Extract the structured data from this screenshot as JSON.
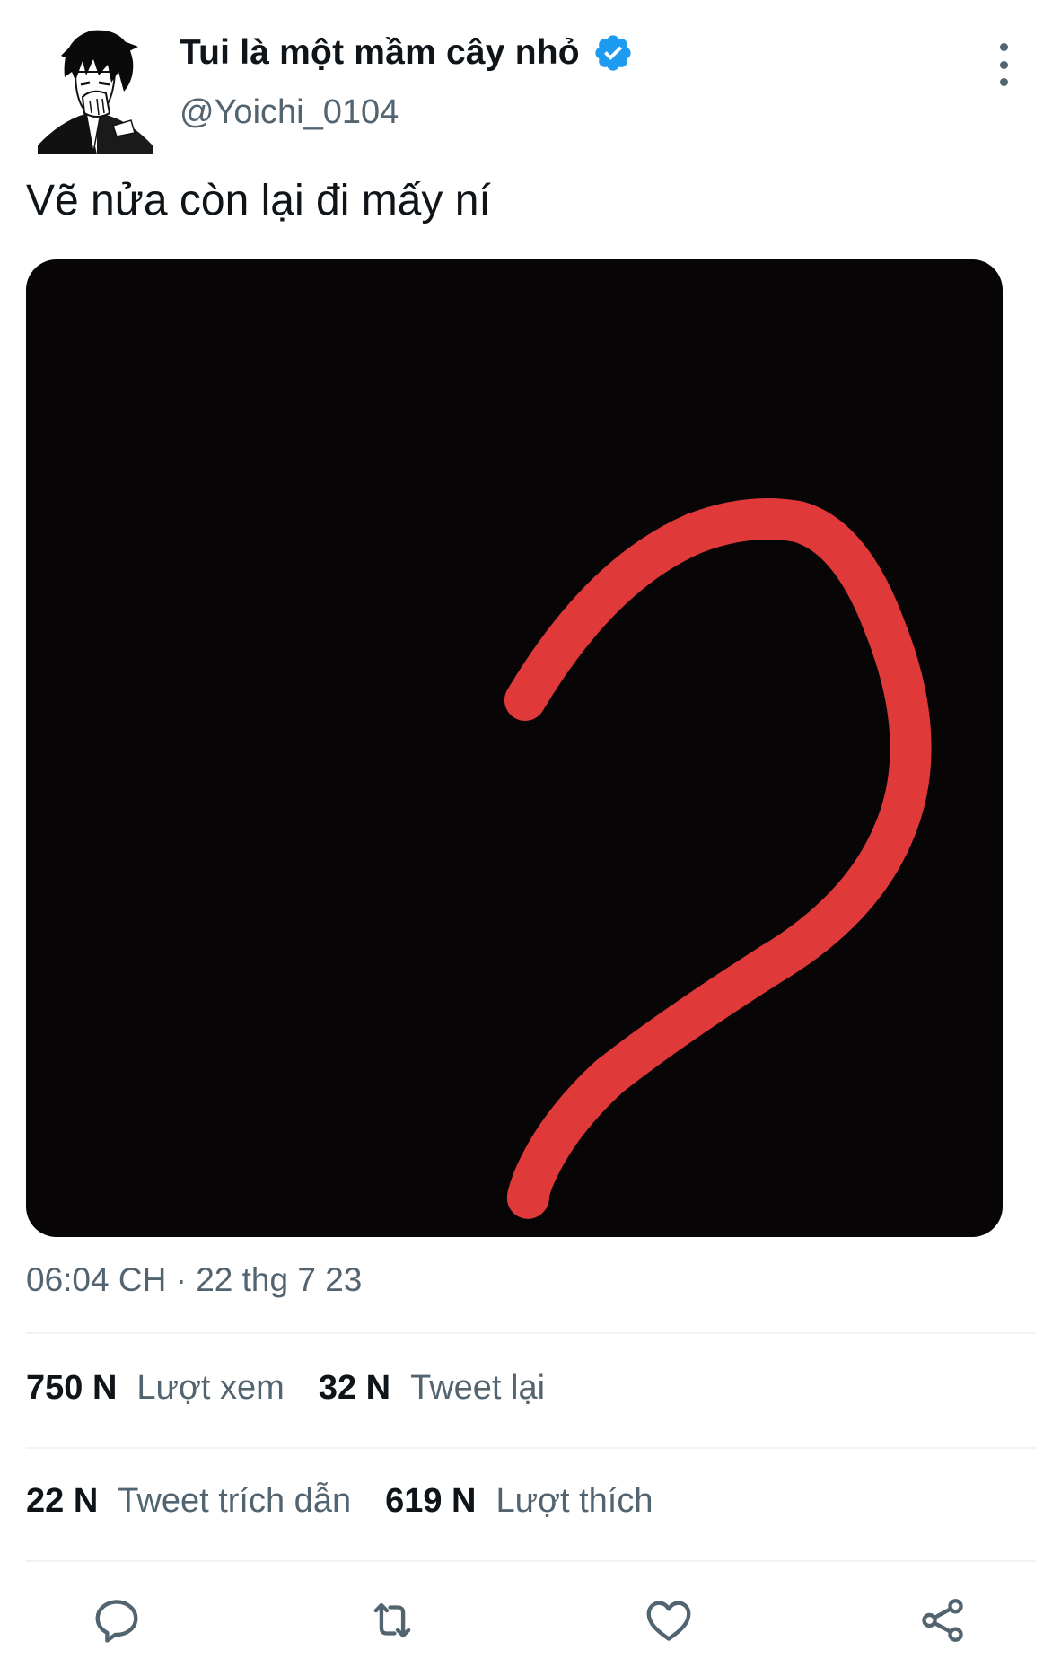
{
  "author": {
    "display_name": "Tui là một mầm cây nhỏ",
    "handle": "@Yoichi_0104",
    "verified": true,
    "verified_color": "#1d9bf0"
  },
  "tweet": {
    "text": "Vẽ nửa còn lại đi mấy ní",
    "media_description_icon": "red-stroke-drawing",
    "stroke_color": "#e0393a",
    "timestamp": "06:04 CH · 22 thg 7 23"
  },
  "stats": {
    "views": {
      "count": "750 N",
      "label": "Lượt xem"
    },
    "retweets": {
      "count": "32 N",
      "label": "Tweet lại"
    },
    "quotes": {
      "count": "22 N",
      "label": "Tweet trích dẫn"
    },
    "likes": {
      "count": "619 N",
      "label": "Lượt thích"
    }
  },
  "actions": [
    {
      "name": "reply",
      "icon": "comment-icon"
    },
    {
      "name": "retweet",
      "icon": "retweet-icon"
    },
    {
      "name": "like",
      "icon": "heart-icon"
    },
    {
      "name": "share",
      "icon": "share-icon"
    }
  ],
  "colors": {
    "text_primary": "#0f1419",
    "text_secondary": "#536471",
    "divider": "#eff3f4"
  }
}
